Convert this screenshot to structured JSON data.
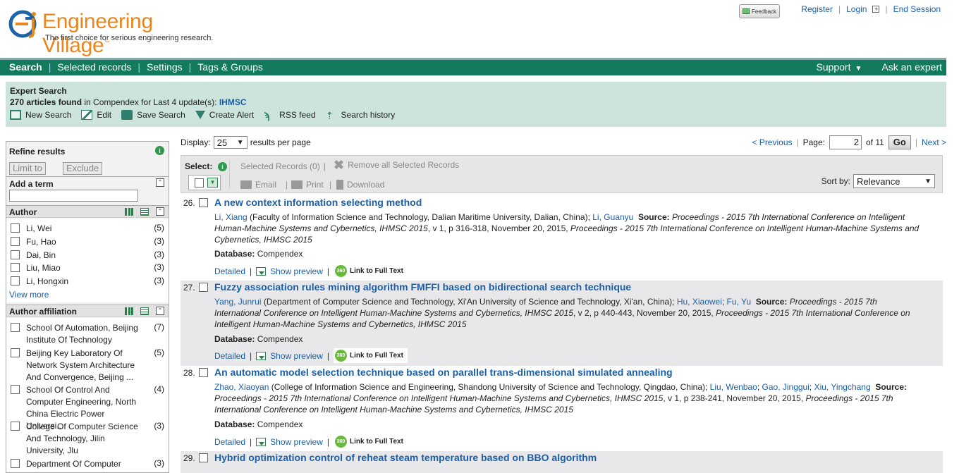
{
  "header": {
    "logo_title": "Engineering Village",
    "logo_tm": "™",
    "tagline": "The first choice for serious engineering research.",
    "feedback_label": "Feedback",
    "register": "Register",
    "login": "Login",
    "end_session": "End Session"
  },
  "nav": {
    "left": [
      "Search",
      "Selected records",
      "Settings",
      "Tags & Groups"
    ],
    "support": "Support",
    "ask_expert": "Ask an expert"
  },
  "summary": {
    "title": "Expert Search",
    "count": "270 articles found",
    "in_text": " in Compendex for Last 4 update(s): ",
    "query": "IHMSC",
    "actions": [
      "New Search",
      "Edit",
      "Save Search",
      "Create Alert",
      "RSS feed",
      "Search history"
    ]
  },
  "refine": {
    "title": "Refine results",
    "limit_to": "Limit to",
    "exclude": "Exclude",
    "add_term": "Add a term",
    "author_title": "Author",
    "authors": [
      {
        "name": "Li, Wei",
        "count": "(5)"
      },
      {
        "name": "Fu, Hao",
        "count": "(3)"
      },
      {
        "name": "Dai, Bin",
        "count": "(3)"
      },
      {
        "name": "Liu, Miao",
        "count": "(3)"
      },
      {
        "name": "Li, Hongxin",
        "count": "(3)"
      }
    ],
    "view_more": "View more",
    "affiliation_title": "Author affiliation",
    "affiliations": [
      {
        "name": "School Of Automation, Beijing Institute Of Technology",
        "count": "(7)"
      },
      {
        "name": "Beijing Key Laboratory Of Network System Architecture And Convergence, Beijing ...",
        "count": "(5)"
      },
      {
        "name": "School Of Control And Computer Engineering, North China Electric Power Universi...",
        "count": "(4)"
      },
      {
        "name": "College Of Computer Science And Technology, Jilin University, Jlu",
        "count": "(3)"
      },
      {
        "name": "Department Of Computer",
        "count": "(3)"
      }
    ]
  },
  "display": {
    "label": "Display:",
    "per_page": "25",
    "suffix": "results per page"
  },
  "pager": {
    "previous": "< Previous",
    "page_label": "Page:",
    "page": "2",
    "of": "of 11",
    "go": "Go",
    "next": "Next >"
  },
  "toolbar": {
    "select": "Select:",
    "selected_records": "Selected Records (0)",
    "remove_all": "Remove all Selected Records",
    "email": "Email",
    "print": "Print",
    "download": "Download",
    "sort_by": "Sort by:",
    "sort_value": "Relevance"
  },
  "results": [
    {
      "num": "26.",
      "title": "A new context information selecting method",
      "authors": [
        "Li, Xiang"
      ],
      "affil": " (Faculty of Information Science and Technology, Dalian Maritime University, Dalian, China); ",
      "coauthors": [
        "Li, Guanyu"
      ],
      "source_label": "Source:",
      "source": "Proceedings - 2015 7th International Conference on Intelligent Human-Machine Systems and Cybernetics, IHMSC 2015",
      "details": ", v 1, p 316-318, November 20, 2015, ",
      "source2": "Proceedings - 2015 7th International Conference on Intelligent Human-Machine Systems and Cybernetics, IHMSC 2015",
      "database_label": "Database:",
      "database": "Compendex",
      "detailed": "Detailed",
      "show_preview": "Show preview",
      "full_text": "Link to Full Text",
      "badge": "360"
    },
    {
      "num": "27.",
      "title": "Fuzzy association rules mining algorithm FMFFI based on bidirectional search technique",
      "authors": [
        "Yang, Junrui"
      ],
      "affil": " (Department of Computer Science and Technology, Xi'An University of Science and Technology, Xi'an, China); ",
      "coauthors": [
        "Hu, Xiaowei",
        "Fu, Yu"
      ],
      "source_label": "Source:",
      "source": "Proceedings - 2015 7th International Conference on Intelligent Human-Machine Systems and Cybernetics, IHMSC 2015",
      "details": ", v 2, p 440-443, November 20, 2015, ",
      "source2": "Proceedings - 2015 7th International Conference on Intelligent Human-Machine Systems and Cybernetics, IHMSC 2015",
      "database_label": "Database:",
      "database": "Compendex",
      "detailed": "Detailed",
      "show_preview": "Show preview",
      "full_text": "Link to Full Text",
      "badge": "360"
    },
    {
      "num": "28.",
      "title": "An automatic model selection technique based on parallel trans-dimensional simulated annealing",
      "authors": [
        "Zhao, Xiaoyan"
      ],
      "affil": " (College of Information Science and Engineering, Shandong University of Science and Technology, Qingdao, China); ",
      "coauthors": [
        "Liu, Wenbao",
        "Gao, Jinggui",
        "Xiu, Yingchang"
      ],
      "source_label": "Source:",
      "source": "Proceedings - 2015 7th International Conference on Intelligent Human-Machine Systems and Cybernetics, IHMSC 2015",
      "details": ", v 1, p 238-241, November 20, 2015, ",
      "source2": "Proceedings - 2015 7th International Conference on Intelligent Human-Machine Systems and Cybernetics, IHMSC 2015",
      "database_label": "Database:",
      "database": "Compendex",
      "detailed": "Detailed",
      "show_preview": "Show preview",
      "full_text": "Link to Full Text",
      "badge": "360"
    },
    {
      "num": "29.",
      "title": "Hybrid optimization control of reheat steam temperature based on BBO algorithm"
    }
  ]
}
